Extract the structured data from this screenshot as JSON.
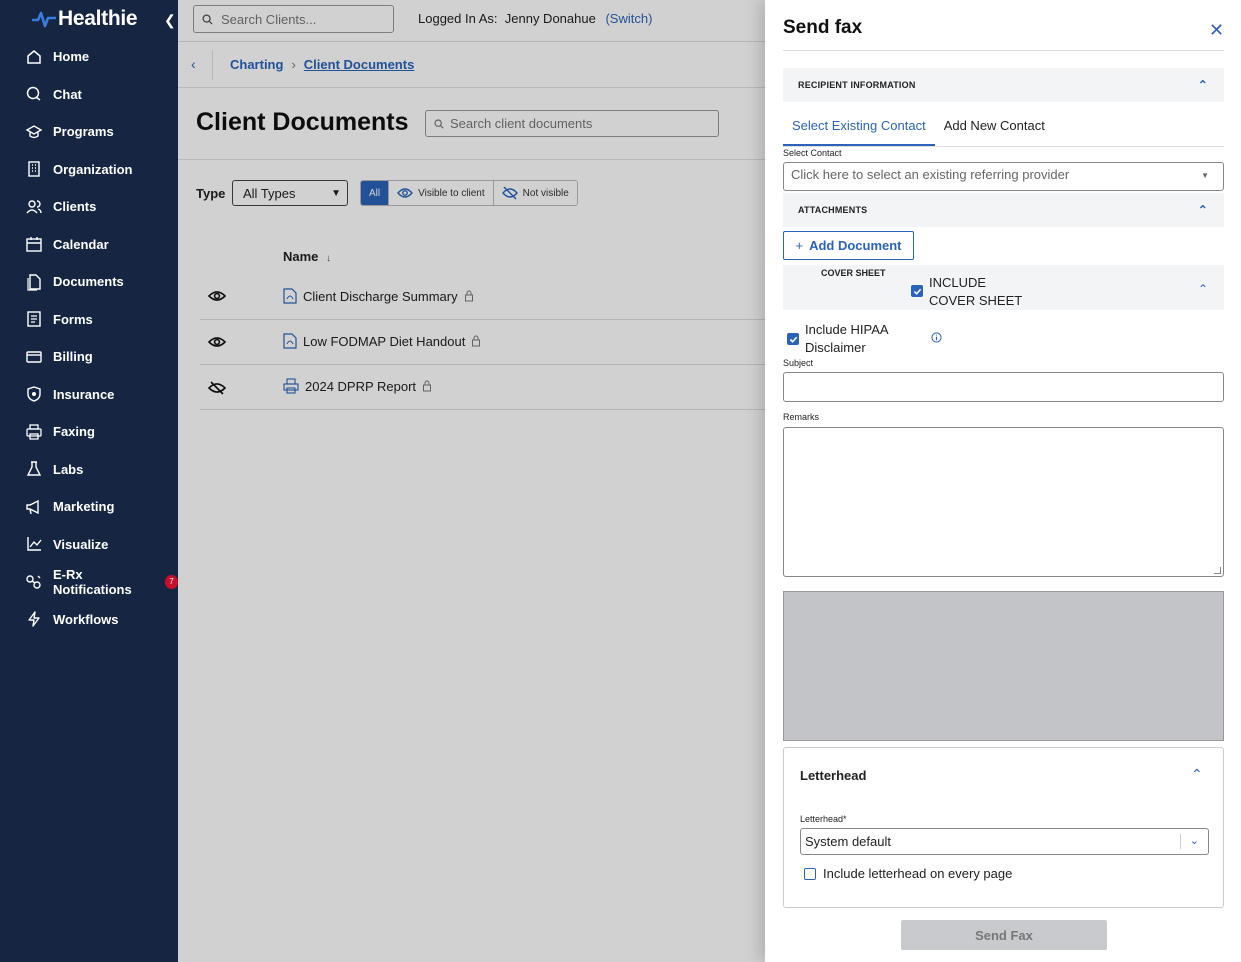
{
  "app": {
    "brand": "Healthie",
    "collapse_icon": "chevron-left-icon"
  },
  "sidebar": {
    "items": [
      {
        "label": "Home",
        "icon": "home-icon"
      },
      {
        "label": "Chat",
        "icon": "chat-icon"
      },
      {
        "label": "Programs",
        "icon": "programs-icon"
      },
      {
        "label": "Organization",
        "icon": "building-icon"
      },
      {
        "label": "Clients",
        "icon": "users-icon"
      },
      {
        "label": "Calendar",
        "icon": "calendar-icon"
      },
      {
        "label": "Documents",
        "icon": "documents-icon"
      },
      {
        "label": "Forms",
        "icon": "forms-icon"
      },
      {
        "label": "Billing",
        "icon": "billing-icon"
      },
      {
        "label": "Insurance",
        "icon": "shield-icon"
      },
      {
        "label": "Faxing",
        "icon": "printer-icon"
      },
      {
        "label": "Labs",
        "icon": "flask-icon"
      },
      {
        "label": "Marketing",
        "icon": "megaphone-icon"
      },
      {
        "label": "Visualize",
        "icon": "chart-icon"
      },
      {
        "label": "E-Rx Notifications",
        "icon": "pills-icon",
        "badge": "7"
      },
      {
        "label": "Workflows",
        "icon": "bolt-icon"
      }
    ]
  },
  "topbar": {
    "search_placeholder": "Search Clients...",
    "logged_in_label": "Logged In As:",
    "user_name": "Jenny Donahue",
    "switch_label": "(Switch)"
  },
  "breadcrumb": {
    "items": [
      "Charting",
      "Client Documents"
    ]
  },
  "page": {
    "title": "Client Documents",
    "search_placeholder": "Search client documents",
    "type_label": "Type",
    "type_value": "All Types",
    "visibility": {
      "all": "All",
      "visible": "Visible to client",
      "hidden": "Not visible"
    },
    "column_name": "Name",
    "documents": [
      {
        "name": "Client Discharge Summary",
        "visible": true
      },
      {
        "name": "Low FODMAP Diet Handout",
        "visible": true
      },
      {
        "name": "2024 DPRP Report",
        "visible": false
      }
    ]
  },
  "drawer": {
    "title": "Send fax",
    "recipient_section": "RECIPIENT INFORMATION",
    "tabs": [
      "Select Existing Contact",
      "Add New Contact"
    ],
    "select_contact_label": "Select Contact",
    "select_contact_placeholder": "Click here to select an existing referring provider",
    "attachments_section": "ATTACHMENTS",
    "add_document_label": "Add Document",
    "cover_sheet_label": "COVER SHEET",
    "include_cover_line1": "INCLUDE",
    "include_cover_line2": "COVER SHEET",
    "include_cover_checked": true,
    "hipaa_line1": "Include HIPAA",
    "hipaa_line2": "Disclaimer",
    "hipaa_checked": true,
    "subject_label": "Subject",
    "subject_value": "",
    "remarks_label": "Remarks",
    "remarks_value": "",
    "letterhead_title": "Letterhead",
    "letterhead_label": "Letterhead*",
    "letterhead_value": "System default",
    "letterhead_every_page_label": "Include letterhead on every page",
    "letterhead_every_page_checked": false,
    "send_label": "Send Fax"
  },
  "colors": {
    "sidebar_bg": "#152542",
    "accent": "#2b63b9",
    "badge": "#c8102e"
  }
}
